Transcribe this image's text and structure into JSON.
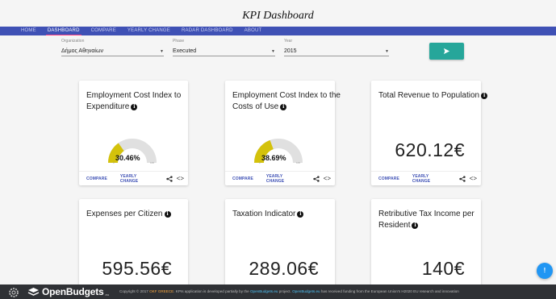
{
  "page_title": "KPI Dashboard",
  "nav": [
    {
      "label": "HOME",
      "active": false
    },
    {
      "label": "DASHBOARD",
      "active": true
    },
    {
      "label": "COMPARE",
      "active": false
    },
    {
      "label": "YEARLY CHANGE",
      "active": false
    },
    {
      "label": "RADAR DASHBOARD",
      "active": false
    },
    {
      "label": "ABOUT",
      "active": false
    }
  ],
  "filters": {
    "organization": {
      "label": "Organization",
      "value": "Δήμος Αθηναίων"
    },
    "phase": {
      "label": "Phase",
      "value": "Executed"
    },
    "year": {
      "label": "Year",
      "value": "2015"
    }
  },
  "colors": {
    "primary": "#3f51b5",
    "accent": "#ff4081",
    "go_button": "#26a69a",
    "gauge_fill": "#d4c20b",
    "gauge_track": "#e0e0e0",
    "fab": "#2196f3",
    "footer": "#2f3135"
  },
  "card_actions": {
    "compare": "COMPARE",
    "yearly_change": "YEARLY CHANGE",
    "code_glyph": "<>"
  },
  "cards": [
    {
      "title": "Employment Cost Index to Expenditure",
      "type": "gauge",
      "value": "30.46%",
      "percent": 30.46,
      "min": "0",
      "max": "100"
    },
    {
      "title": "Employment Cost Index to the Costs of Use",
      "type": "gauge",
      "value": "38.69%",
      "percent": 38.69,
      "min": "0",
      "max": "100"
    },
    {
      "title": "Total Revenue to Population",
      "type": "number",
      "value": "620.12€"
    },
    {
      "title": "Expenses per Citizen",
      "type": "number",
      "value": "595.56€"
    },
    {
      "title": "Taxation Indicator",
      "type": "number",
      "value": "289.06€"
    },
    {
      "title": "Retributive Tax Income per Resident",
      "type": "number",
      "value": "140€"
    }
  ],
  "fab_label": "!",
  "footer": {
    "brand": "OpenBudgets",
    "brand_suffix": ".eu",
    "text_prefix": "Copyright © 2017",
    "link_org": "OKF GREECE",
    "text_mid": ". KPIs application is developed partially by the",
    "link_project": "OpenBudgets.eu",
    "text_mid2": "project.",
    "link_project2": "OpenBudgets.eu",
    "text_suffix": "has received funding from the European Union's H2020 EU research and innovation"
  }
}
